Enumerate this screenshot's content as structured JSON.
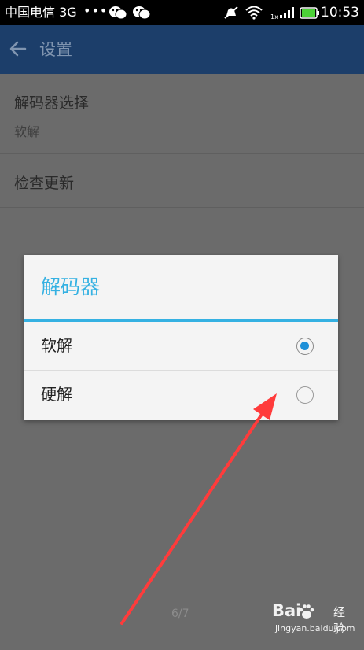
{
  "status_bar": {
    "carrier": "中国电信 3G",
    "dots": "•••",
    "signal_label": "1x",
    "time": "10:53",
    "icons": [
      "wechat-icon",
      "wechat-icon",
      "mute-icon",
      "wifi-icon",
      "signal-icon",
      "battery-icon"
    ]
  },
  "action_bar": {
    "back_icon": "back-arrow-icon",
    "title": "设置"
  },
  "settings": {
    "decoder_title": "解码器选择",
    "decoder_summary": "软解",
    "update_title": "检查更新"
  },
  "dialog": {
    "title": "解码器",
    "options": [
      {
        "label": "软解",
        "selected": true
      },
      {
        "label": "硬解",
        "selected": false
      }
    ]
  },
  "page_counter": "6/7",
  "watermark": {
    "logo": "Bai",
    "logo_suffix": "经验",
    "url": "jingyan.baidu.com"
  },
  "colors": {
    "accent": "#35b1e2",
    "radio_checked": "#1e90d8",
    "annotation_arrow": "#ff3b3b"
  }
}
